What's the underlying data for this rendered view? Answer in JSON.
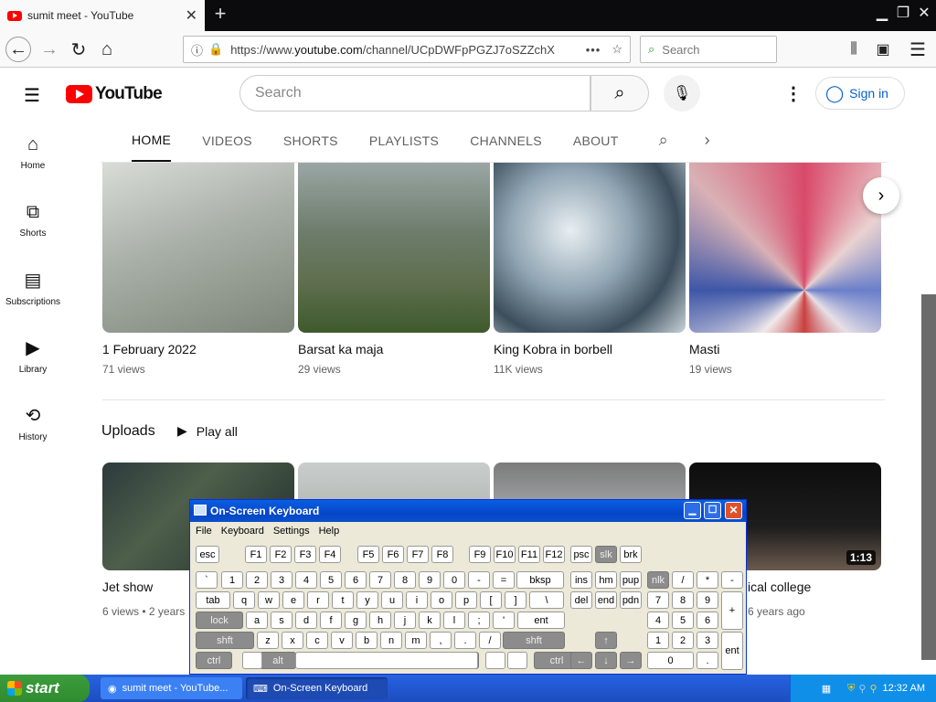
{
  "browser": {
    "tab_title": "sumit meet - YouTube",
    "url_prefix": "https://www.",
    "url_host": "youtube.com",
    "url_rest": "/channel/UCpDWFpPGZJ7oSZZchX",
    "search_placeholder": "Search"
  },
  "youtube": {
    "logo_text": "YouTube",
    "search_placeholder": "Search",
    "sign_in": "Sign in",
    "sidebar": [
      {
        "label": "Home",
        "icon": "home-icon"
      },
      {
        "label": "Shorts",
        "icon": "shorts-icon"
      },
      {
        "label": "Subscriptions",
        "icon": "subscriptions-icon"
      },
      {
        "label": "Library",
        "icon": "library-icon"
      },
      {
        "label": "History",
        "icon": "history-icon"
      }
    ],
    "tabs": [
      "HOME",
      "VIDEOS",
      "SHORTS",
      "PLAYLISTS",
      "CHANNELS",
      "ABOUT"
    ],
    "row1": [
      {
        "title": "1 February 2022",
        "meta": "71 views"
      },
      {
        "title": "Barsat ka maja",
        "meta": "29 views"
      },
      {
        "title": "King Kobra in borbell",
        "meta": "11K views"
      },
      {
        "title": "Masti",
        "meta": "19 views"
      }
    ],
    "uploads_label": "Uploads",
    "play_all": "Play all",
    "row2": [
      {
        "title": "Jet show",
        "meta": "6 views • 2 years"
      },
      {
        "title": "ical college",
        "meta": "6 years ago",
        "duration": "1:13"
      }
    ]
  },
  "osk": {
    "title": "On-Screen Keyboard",
    "menu": [
      "File",
      "Keyboard",
      "Settings",
      "Help"
    ],
    "rows": [
      [
        "esc",
        "F1",
        "F2",
        "F3",
        "F4",
        "F5",
        "F6",
        "F7",
        "F8",
        "F9",
        "F10",
        "F11",
        "F12",
        "psc",
        "slk",
        "brk"
      ],
      [
        "`",
        "1",
        "2",
        "3",
        "4",
        "5",
        "6",
        "7",
        "8",
        "9",
        "0",
        "-",
        "=",
        "bksp",
        "ins",
        "hm",
        "pup",
        "nlk",
        "/",
        "*",
        "-"
      ],
      [
        "tab",
        "q",
        "w",
        "e",
        "r",
        "t",
        "y",
        "u",
        "i",
        "o",
        "p",
        "[",
        "]",
        "\\",
        "del",
        "end",
        "pdn",
        "7",
        "8",
        "9",
        "+"
      ],
      [
        "lock",
        "a",
        "s",
        "d",
        "f",
        "g",
        "h",
        "j",
        "k",
        "l",
        ";",
        "'",
        "ent",
        "4",
        "5",
        "6"
      ],
      [
        "shft",
        "z",
        "x",
        "c",
        "v",
        "b",
        "n",
        "m",
        ",",
        ".",
        "/",
        "shft",
        "1",
        "2",
        "3",
        "ent"
      ],
      [
        "ctrl",
        "alt",
        "alt",
        "ctrl",
        "0",
        "."
      ]
    ]
  },
  "taskbar": {
    "start": "start",
    "items": [
      "sumit meet - YouTube...",
      "On-Screen Keyboard"
    ],
    "time": "12:32 AM"
  }
}
